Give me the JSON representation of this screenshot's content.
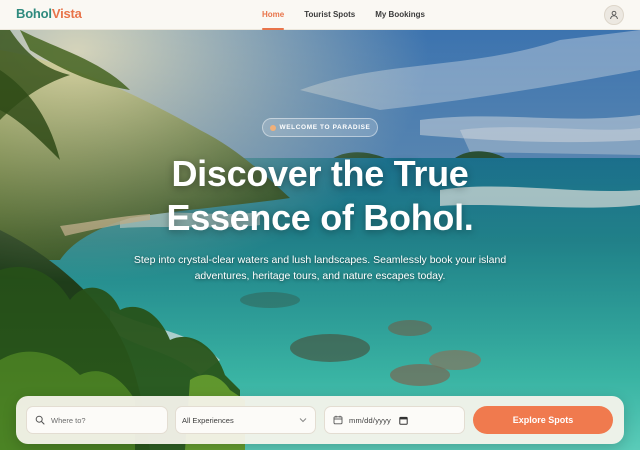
{
  "brand": {
    "part1": "Bohol",
    "part2": "Vista",
    "color1": "#2f8a7e",
    "color2": "#e8744a"
  },
  "nav": {
    "links": [
      {
        "label": "Home",
        "active": true
      },
      {
        "label": "Tourist Spots",
        "active": false
      },
      {
        "label": "My Bookings",
        "active": false
      }
    ],
    "profile_icon": "user-icon"
  },
  "hero": {
    "badge": "WELCOME TO PARADISE",
    "title_line1": "Discover the True",
    "title_line2": "Essence of Bohol.",
    "subtitle": "Step into crystal-clear waters and lush landscapes. Seamlessly book your island adventures, heritage tours, and nature escapes today."
  },
  "search": {
    "where_placeholder": "Where to?",
    "experience_selected": "All Experiences",
    "date_placeholder": "mm/dd/yyyy",
    "button_label": "Explore Spots",
    "accent": "#f07a4e"
  }
}
